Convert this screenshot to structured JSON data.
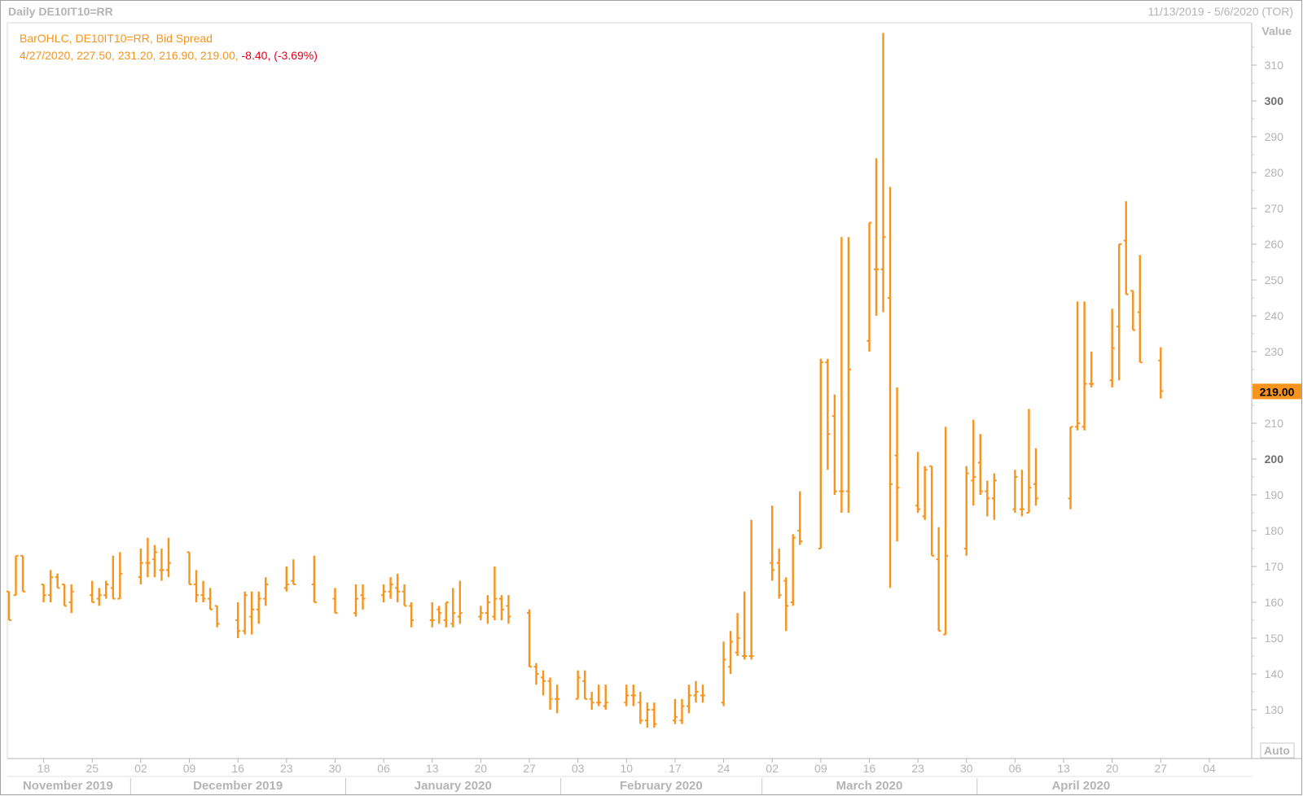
{
  "header": {
    "left": "Daily DE10IT10=RR",
    "right": "11/13/2019 - 5/6/2020 (TOR)"
  },
  "legend": {
    "line1": "BarOHLC, DE10IT10=RR, Bid Spread",
    "date": "4/27/2020",
    "open": "227.50",
    "high": "231.20",
    "low": "216.90",
    "close": "219.00",
    "change": "-8.40",
    "change_pct": "(-3.69%)"
  },
  "axis": {
    "value_label": "Value",
    "auto_label": "Auto",
    "last_price": "219.00"
  },
  "colors": {
    "bar": "#f7941d",
    "negative": "#e8001c",
    "axis_text": "#b4b4b4"
  },
  "chart_data": {
    "type": "ohlc",
    "ylim": [
      124,
      318
    ],
    "y_ticks": [
      130,
      140,
      150,
      160,
      170,
      180,
      190,
      200,
      210,
      220,
      230,
      240,
      250,
      260,
      270,
      280,
      290,
      300,
      310
    ],
    "y_major": [
      200,
      300
    ],
    "x_tick_labels": [
      {
        "date": "2019-11-18",
        "label": "18"
      },
      {
        "date": "2019-11-25",
        "label": "25"
      },
      {
        "date": "2019-12-02",
        "label": "02"
      },
      {
        "date": "2019-12-09",
        "label": "09"
      },
      {
        "date": "2019-12-16",
        "label": "16"
      },
      {
        "date": "2019-12-23",
        "label": "23"
      },
      {
        "date": "2019-12-30",
        "label": "30"
      },
      {
        "date": "2020-01-06",
        "label": "06"
      },
      {
        "date": "2020-01-13",
        "label": "13"
      },
      {
        "date": "2020-01-20",
        "label": "20"
      },
      {
        "date": "2020-01-27",
        "label": "27"
      },
      {
        "date": "2020-02-03",
        "label": "03"
      },
      {
        "date": "2020-02-10",
        "label": "10"
      },
      {
        "date": "2020-02-17",
        "label": "17"
      },
      {
        "date": "2020-02-24",
        "label": "24"
      },
      {
        "date": "2020-03-02",
        "label": "02"
      },
      {
        "date": "2020-03-09",
        "label": "09"
      },
      {
        "date": "2020-03-16",
        "label": "16"
      },
      {
        "date": "2020-03-23",
        "label": "23"
      },
      {
        "date": "2020-03-30",
        "label": "30"
      },
      {
        "date": "2020-04-06",
        "label": "06"
      },
      {
        "date": "2020-04-13",
        "label": "13"
      },
      {
        "date": "2020-04-20",
        "label": "20"
      },
      {
        "date": "2020-04-27",
        "label": "27"
      },
      {
        "date": "2020-05-04",
        "label": "04"
      }
    ],
    "months": [
      {
        "label": "November 2019",
        "start": "2019-11-13",
        "end": "2019-11-30"
      },
      {
        "label": "December 2019",
        "start": "2019-12-01",
        "end": "2019-12-31"
      },
      {
        "label": "January 2020",
        "start": "2020-01-01",
        "end": "2020-01-31"
      },
      {
        "label": "February 2020",
        "start": "2020-02-01",
        "end": "2020-02-29"
      },
      {
        "label": "March 2020",
        "start": "2020-03-01",
        "end": "2020-03-31"
      },
      {
        "label": "April 2020",
        "start": "2020-04-01",
        "end": "2020-04-30"
      }
    ],
    "bars": [
      {
        "date": "2019-11-13",
        "o": 163,
        "h": 163,
        "l": 155,
        "c": 155
      },
      {
        "date": "2019-11-14",
        "o": 162,
        "h": 173,
        "l": 162,
        "c": 173
      },
      {
        "date": "2019-11-15",
        "o": 173,
        "h": 173,
        "l": 163,
        "c": 163
      },
      {
        "date": "2019-11-18",
        "o": 165,
        "h": 165,
        "l": 160,
        "c": 162
      },
      {
        "date": "2019-11-19",
        "o": 162,
        "h": 169,
        "l": 160,
        "c": 167
      },
      {
        "date": "2019-11-20",
        "o": 167,
        "h": 168,
        "l": 164,
        "c": 164
      },
      {
        "date": "2019-11-21",
        "o": 165,
        "h": 165,
        "l": 159,
        "c": 159
      },
      {
        "date": "2019-11-22",
        "o": 160,
        "h": 165,
        "l": 157,
        "c": 163
      },
      {
        "date": "2019-11-25",
        "o": 162,
        "h": 166,
        "l": 160,
        "c": 160
      },
      {
        "date": "2019-11-26",
        "o": 161,
        "h": 164,
        "l": 159,
        "c": 162
      },
      {
        "date": "2019-11-27",
        "o": 162,
        "h": 166,
        "l": 161,
        "c": 165
      },
      {
        "date": "2019-11-28",
        "o": 164,
        "h": 173,
        "l": 161,
        "c": 161
      },
      {
        "date": "2019-11-29",
        "o": 161,
        "h": 174,
        "l": 161,
        "c": 168
      },
      {
        "date": "2019-12-02",
        "o": 167,
        "h": 175,
        "l": 165,
        "c": 171
      },
      {
        "date": "2019-12-03",
        "o": 171,
        "h": 178,
        "l": 167,
        "c": 171
      },
      {
        "date": "2019-12-04",
        "o": 172,
        "h": 176,
        "l": 167,
        "c": 174
      },
      {
        "date": "2019-12-05",
        "o": 169,
        "h": 175,
        "l": 166,
        "c": 169
      },
      {
        "date": "2019-12-06",
        "o": 169,
        "h": 178,
        "l": 167,
        "c": 171
      },
      {
        "date": "2019-12-09",
        "o": 174,
        "h": 174,
        "l": 165,
        "c": 165
      },
      {
        "date": "2019-12-10",
        "o": 165,
        "h": 169,
        "l": 160,
        "c": 162
      },
      {
        "date": "2019-12-11",
        "o": 162,
        "h": 166,
        "l": 160,
        "c": 161
      },
      {
        "date": "2019-12-12",
        "o": 161,
        "h": 164,
        "l": 158,
        "c": 158
      },
      {
        "date": "2019-12-13",
        "o": 159,
        "h": 159,
        "l": 153,
        "c": 154
      },
      {
        "date": "2019-12-16",
        "o": 155,
        "h": 160,
        "l": 150,
        "c": 152
      },
      {
        "date": "2019-12-17",
        "o": 152,
        "h": 163,
        "l": 151,
        "c": 162
      },
      {
        "date": "2019-12-18",
        "o": 156,
        "h": 163,
        "l": 151,
        "c": 158
      },
      {
        "date": "2019-12-19",
        "o": 158,
        "h": 163,
        "l": 154,
        "c": 161
      },
      {
        "date": "2019-12-20",
        "o": 161,
        "h": 167,
        "l": 159,
        "c": 165
      },
      {
        "date": "2019-12-23",
        "o": 164,
        "h": 170,
        "l": 163,
        "c": 165
      },
      {
        "date": "2019-12-24",
        "o": 166,
        "h": 172,
        "l": 165,
        "c": 165
      },
      {
        "date": "2019-12-27",
        "o": 165,
        "h": 173,
        "l": 160,
        "c": 160
      },
      {
        "date": "2019-12-30",
        "o": 161,
        "h": 164,
        "l": 157,
        "c": 157
      },
      {
        "date": "2020-01-02",
        "o": 157,
        "h": 165,
        "l": 156,
        "c": 161
      },
      {
        "date": "2020-01-03",
        "o": 162,
        "h": 165,
        "l": 158,
        "c": 161
      },
      {
        "date": "2020-01-06",
        "o": 162,
        "h": 165,
        "l": 160,
        "c": 163
      },
      {
        "date": "2020-01-07",
        "o": 163,
        "h": 167,
        "l": 161,
        "c": 165
      },
      {
        "date": "2020-01-08",
        "o": 164,
        "h": 168,
        "l": 160,
        "c": 163
      },
      {
        "date": "2020-01-09",
        "o": 163,
        "h": 165,
        "l": 159,
        "c": 159
      },
      {
        "date": "2020-01-10",
        "o": 159,
        "h": 160,
        "l": 153,
        "c": 155
      },
      {
        "date": "2020-01-13",
        "o": 155,
        "h": 160,
        "l": 153,
        "c": 155
      },
      {
        "date": "2020-01-14",
        "o": 158,
        "h": 159,
        "l": 154,
        "c": 157
      },
      {
        "date": "2020-01-15",
        "o": 155,
        "h": 160,
        "l": 153,
        "c": 160
      },
      {
        "date": "2020-01-16",
        "o": 154,
        "h": 164,
        "l": 153,
        "c": 157
      },
      {
        "date": "2020-01-17",
        "o": 156,
        "h": 166,
        "l": 154,
        "c": 157
      },
      {
        "date": "2020-01-20",
        "o": 156,
        "h": 159,
        "l": 155,
        "c": 157
      },
      {
        "date": "2020-01-21",
        "o": 157,
        "h": 162,
        "l": 154,
        "c": 160
      },
      {
        "date": "2020-01-22",
        "o": 156,
        "h": 170,
        "l": 155,
        "c": 161
      },
      {
        "date": "2020-01-23",
        "o": 161,
        "h": 162,
        "l": 155,
        "c": 158
      },
      {
        "date": "2020-01-24",
        "o": 159,
        "h": 162,
        "l": 154,
        "c": 156
      },
      {
        "date": "2020-01-27",
        "o": 157,
        "h": 158,
        "l": 142,
        "c": 142
      },
      {
        "date": "2020-01-28",
        "o": 142,
        "h": 143,
        "l": 137,
        "c": 140
      },
      {
        "date": "2020-01-29",
        "o": 139,
        "h": 141,
        "l": 134,
        "c": 138
      },
      {
        "date": "2020-01-30",
        "o": 138,
        "h": 139,
        "l": 130,
        "c": 133
      },
      {
        "date": "2020-01-31",
        "o": 133,
        "h": 137,
        "l": 129,
        "c": 133
      },
      {
        "date": "2020-02-03",
        "o": 133,
        "h": 141,
        "l": 133,
        "c": 139
      },
      {
        "date": "2020-02-04",
        "o": 138,
        "h": 141,
        "l": 133,
        "c": 133
      },
      {
        "date": "2020-02-05",
        "o": 133,
        "h": 135,
        "l": 130,
        "c": 132
      },
      {
        "date": "2020-02-06",
        "o": 132,
        "h": 137,
        "l": 131,
        "c": 132
      },
      {
        "date": "2020-02-07",
        "o": 131,
        "h": 137,
        "l": 130,
        "c": 132
      },
      {
        "date": "2020-02-10",
        "o": 132,
        "h": 137,
        "l": 131,
        "c": 134
      },
      {
        "date": "2020-02-11",
        "o": 134,
        "h": 137,
        "l": 131,
        "c": 134
      },
      {
        "date": "2020-02-12",
        "o": 132,
        "h": 135,
        "l": 126,
        "c": 127
      },
      {
        "date": "2020-02-13",
        "o": 127,
        "h": 132,
        "l": 125,
        "c": 130
      },
      {
        "date": "2020-02-14",
        "o": 130,
        "h": 132,
        "l": 125,
        "c": 126
      },
      {
        "date": "2020-02-17",
        "o": 127,
        "h": 133,
        "l": 126,
        "c": 128
      },
      {
        "date": "2020-02-18",
        "o": 127,
        "h": 133,
        "l": 126,
        "c": 131
      },
      {
        "date": "2020-02-19",
        "o": 131,
        "h": 137,
        "l": 129,
        "c": 134
      },
      {
        "date": "2020-02-20",
        "o": 134,
        "h": 138,
        "l": 132,
        "c": 135
      },
      {
        "date": "2020-02-21",
        "o": 134,
        "h": 137,
        "l": 132,
        "c": 134
      },
      {
        "date": "2020-02-24",
        "o": 132,
        "h": 149,
        "l": 131,
        "c": 144
      },
      {
        "date": "2020-02-25",
        "o": 142,
        "h": 152,
        "l": 140,
        "c": 149
      },
      {
        "date": "2020-02-26",
        "o": 146,
        "h": 157,
        "l": 145,
        "c": 150
      },
      {
        "date": "2020-02-27",
        "o": 145,
        "h": 163,
        "l": 144,
        "c": 145
      },
      {
        "date": "2020-02-28",
        "o": 145,
        "h": 183,
        "l": 144,
        "c": 145
      },
      {
        "date": "2020-03-02",
        "o": 171,
        "h": 187,
        "l": 166,
        "c": 169
      },
      {
        "date": "2020-03-03",
        "o": 171,
        "h": 175,
        "l": 161,
        "c": 162
      },
      {
        "date": "2020-03-04",
        "o": 166,
        "h": 167,
        "l": 152,
        "c": 159
      },
      {
        "date": "2020-03-05",
        "o": 160,
        "h": 179,
        "l": 159,
        "c": 178
      },
      {
        "date": "2020-03-06",
        "o": 180,
        "h": 191,
        "l": 176,
        "c": 177
      },
      {
        "date": "2020-03-09",
        "o": 175,
        "h": 228,
        "l": 175,
        "c": 227
      },
      {
        "date": "2020-03-10",
        "o": 227,
        "h": 228,
        "l": 197,
        "c": 207
      },
      {
        "date": "2020-03-11",
        "o": 212,
        "h": 218,
        "l": 190,
        "c": 191
      },
      {
        "date": "2020-03-12",
        "o": 191,
        "h": 262,
        "l": 185,
        "c": 191
      },
      {
        "date": "2020-03-13",
        "o": 191,
        "h": 262,
        "l": 185,
        "c": 225
      },
      {
        "date": "2020-03-16",
        "o": 233,
        "h": 266,
        "l": 230,
        "c": 266
      },
      {
        "date": "2020-03-17",
        "o": 253,
        "h": 284,
        "l": 240,
        "c": 253
      },
      {
        "date": "2020-03-18",
        "o": 253,
        "h": 319,
        "l": 241,
        "c": 262
      },
      {
        "date": "2020-03-19",
        "o": 245,
        "h": 276,
        "l": 164,
        "c": 193
      },
      {
        "date": "2020-03-20",
        "o": 201,
        "h": 220,
        "l": 177,
        "c": 192
      },
      {
        "date": "2020-03-23",
        "o": 187,
        "h": 202,
        "l": 185,
        "c": 186
      },
      {
        "date": "2020-03-24",
        "o": 184,
        "h": 198,
        "l": 183,
        "c": 197
      },
      {
        "date": "2020-03-25",
        "o": 198,
        "h": 198,
        "l": 173,
        "c": 173
      },
      {
        "date": "2020-03-26",
        "o": 172,
        "h": 181,
        "l": 152,
        "c": 152
      },
      {
        "date": "2020-03-27",
        "o": 151,
        "h": 209,
        "l": 151,
        "c": 173
      },
      {
        "date": "2020-03-30",
        "o": 175,
        "h": 198,
        "l": 173,
        "c": 196
      },
      {
        "date": "2020-03-31",
        "o": 194,
        "h": 211,
        "l": 187,
        "c": 195
      },
      {
        "date": "2020-04-01",
        "o": 199,
        "h": 207,
        "l": 190,
        "c": 191
      },
      {
        "date": "2020-04-02",
        "o": 191,
        "h": 194,
        "l": 184,
        "c": 189
      },
      {
        "date": "2020-04-03",
        "o": 189,
        "h": 196,
        "l": 183,
        "c": 194
      },
      {
        "date": "2020-04-06",
        "o": 186,
        "h": 197,
        "l": 185,
        "c": 195
      },
      {
        "date": "2020-04-07",
        "o": 186,
        "h": 197,
        "l": 184,
        "c": 186
      },
      {
        "date": "2020-04-08",
        "o": 185,
        "h": 214,
        "l": 185,
        "c": 192
      },
      {
        "date": "2020-04-09",
        "o": 193,
        "h": 203,
        "l": 187,
        "c": 189
      },
      {
        "date": "2020-04-14",
        "o": 189,
        "h": 209,
        "l": 186,
        "c": 209
      },
      {
        "date": "2020-04-15",
        "o": 209,
        "h": 244,
        "l": 208,
        "c": 210
      },
      {
        "date": "2020-04-16",
        "o": 209,
        "h": 244,
        "l": 208,
        "c": 221
      },
      {
        "date": "2020-04-17",
        "o": 221,
        "h": 230,
        "l": 220,
        "c": 221
      },
      {
        "date": "2020-04-20",
        "o": 222,
        "h": 242,
        "l": 220,
        "c": 231
      },
      {
        "date": "2020-04-21",
        "o": 237,
        "h": 260,
        "l": 222,
        "c": 260
      },
      {
        "date": "2020-04-22",
        "o": 261,
        "h": 272,
        "l": 246,
        "c": 246
      },
      {
        "date": "2020-04-23",
        "o": 247,
        "h": 247,
        "l": 236,
        "c": 236
      },
      {
        "date": "2020-04-24",
        "o": 241,
        "h": 257,
        "l": 227,
        "c": 227
      },
      {
        "date": "2020-04-27",
        "o": 227.5,
        "h": 231.2,
        "l": 216.9,
        "c": 219.0
      }
    ]
  }
}
